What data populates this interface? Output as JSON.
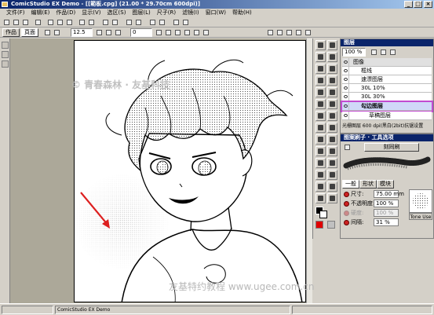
{
  "window": {
    "title": "ComicStudio EX Demo - [[範板.cpg] (21.00 * 29.70cm 600dpi)]"
  },
  "menu": [
    "文件(F)",
    "编辑(E)",
    "作品(D)",
    "显示(V)",
    "选区(S)",
    "图层(L)",
    "尺子(R)",
    "滤镜(I)",
    "窗口(W)",
    "帮助(H)"
  ],
  "toolbar": {
    "tabs": [
      "作品",
      "頁面"
    ],
    "zoom_value": "12.5",
    "angle_value": "0"
  },
  "canvas": {
    "watermark": "© 青春森林 · 友基科技",
    "footer_watermark": "友基特约教程  www.ugee.com.cn"
  },
  "layer_panel": {
    "title": "图层",
    "opacity": "100 %",
    "group": "图像",
    "layers": [
      "框线",
      "速漂图层",
      "30L 10%",
      "30L 30%",
      "勾边图层",
      "草稿图层"
    ],
    "active_index": 4,
    "status": "光栅图层 600 dpi(黑白(2bit)抗锯设置"
  },
  "brush_panel": {
    "title": "图案刷子 · 工具选项",
    "brush_name": "刻同刷",
    "tabs": [
      "一般",
      "形状",
      "模块"
    ],
    "props": [
      {
        "label": "尺寸:",
        "value": "75.00 mm",
        "enabled": true
      },
      {
        "label": "不透明度:",
        "value": "100 %",
        "enabled": true
      },
      {
        "label": "硬度:",
        "value": "100 %",
        "enabled": false
      },
      {
        "label": "间隔:",
        "value": "31 %",
        "enabled": true
      }
    ],
    "preview_label": "Tone Use"
  },
  "statusbar": {
    "text": "ComicStudio EX Demo"
  },
  "colors": {
    "title_active": "#0a246a",
    "panel_face": "#d4d0c8",
    "active_layer_outline": "#c24bd0",
    "arrow": "#dd2020"
  }
}
